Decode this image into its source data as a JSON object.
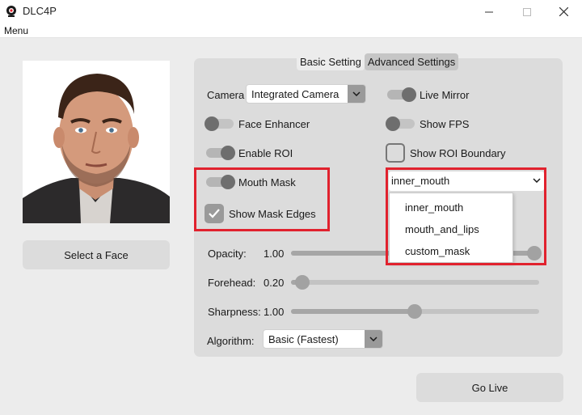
{
  "window": {
    "title": "DLC4P",
    "icon": "webcam-icon"
  },
  "menubar": {
    "menu_label": "Menu"
  },
  "left": {
    "face_image": "face-photo",
    "select_face_label": "Select a Face"
  },
  "tabs": {
    "basic_label": "Basic Setting",
    "advanced_label": "Advanced Settings",
    "active": "Advanced Settings"
  },
  "settings": {
    "camera_label": "Camera",
    "camera_value": "Integrated Camera",
    "live_mirror_label": "Live Mirror",
    "live_mirror_on": true,
    "face_enhancer_label": "Face Enhancer",
    "face_enhancer_on": false,
    "show_fps_label": "Show FPS",
    "show_fps_on": false,
    "enable_roi_label": "Enable ROI",
    "enable_roi_on": true,
    "show_roi_boundary_label": "Show ROI Boundary",
    "show_roi_boundary_checked": false,
    "mouth_mask_label": "Mouth Mask",
    "mouth_mask_on": true,
    "show_mask_edges_label": "Show Mask Edges",
    "show_mask_edges_checked": true,
    "mask_type_value": "inner_mouth",
    "mask_type_options": [
      "inner_mouth",
      "mouth_and_lips",
      "custom_mask"
    ],
    "opacity_label": "Opacity:",
    "opacity_value": "1.00",
    "forehead_label": "Forehead:",
    "forehead_value": "0.20",
    "sharpness_label": "Sharpness:",
    "sharpness_value": "1.00",
    "algorithm_label": "Algorithm:",
    "algorithm_value": "Basic (Fastest)"
  },
  "go_live_label": "Go Live",
  "colors": {
    "highlight": "#e1222e",
    "panel": "#dcdcdc",
    "background": "#ececec"
  }
}
